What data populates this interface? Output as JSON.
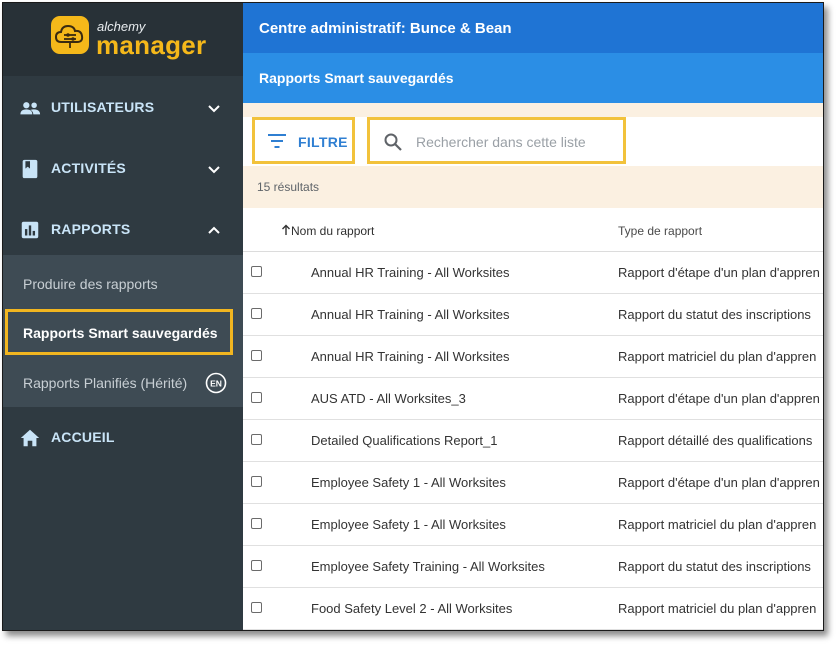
{
  "brand": {
    "logo_small": "alchemy",
    "logo_big": "manager",
    "accent": "#f5b81a"
  },
  "sidebar": {
    "groups": [
      {
        "label": "UTILISATEURS",
        "icon": "people-icon",
        "chevron": "chevron-down-icon"
      },
      {
        "label": "ACTIVITÉS",
        "icon": "book-icon",
        "chevron": "chevron-down-icon"
      },
      {
        "label": "RAPPORTS",
        "icon": "bar-chart-icon",
        "chevron": "chevron-up-icon"
      },
      {
        "label": "ACCUEIL",
        "icon": "home-icon"
      }
    ],
    "report_items": [
      {
        "label": "Produire des rapports"
      },
      {
        "label": "Rapports Smart sauvegardés",
        "active": true
      },
      {
        "label": "Rapports Planifiés (Hérité)",
        "badge_icon": "language-en-icon",
        "badge_text": "EN"
      }
    ]
  },
  "header": {
    "title": "Centre administratif: Bunce & Bean",
    "subtitle": "Rapports Smart sauvegardés"
  },
  "toolbar": {
    "filter_label": "FILTRE",
    "search_placeholder": "Rechercher dans cette liste",
    "result_count": "15 résultats"
  },
  "table": {
    "columns": [
      "Nom du rapport",
      "Type de rapport"
    ],
    "rows": [
      {
        "name": "Annual HR Training - All Worksites",
        "type": "Rapport d'étape d'un plan d'appren"
      },
      {
        "name": "Annual HR Training - All Worksites",
        "type": "Rapport du statut des inscriptions"
      },
      {
        "name": "Annual HR Training - All Worksites",
        "type": "Rapport matriciel du plan d'appren"
      },
      {
        "name": "AUS ATD - All Worksites_3",
        "type": "Rapport d'étape d'un plan d'appren"
      },
      {
        "name": "Detailed Qualifications Report_1",
        "type": "Rapport détaillé des qualifications"
      },
      {
        "name": "Employee Safety 1 - All Worksites",
        "type": "Rapport d'étape d'un plan d'appren"
      },
      {
        "name": "Employee Safety 1 - All Worksites",
        "type": "Rapport matriciel du plan d'appren"
      },
      {
        "name": "Employee Safety Training - All Worksites",
        "type": "Rapport du statut des inscriptions"
      },
      {
        "name": "Food Safety Level 2 - All Worksites",
        "type": "Rapport matriciel du plan d'appren"
      }
    ]
  }
}
